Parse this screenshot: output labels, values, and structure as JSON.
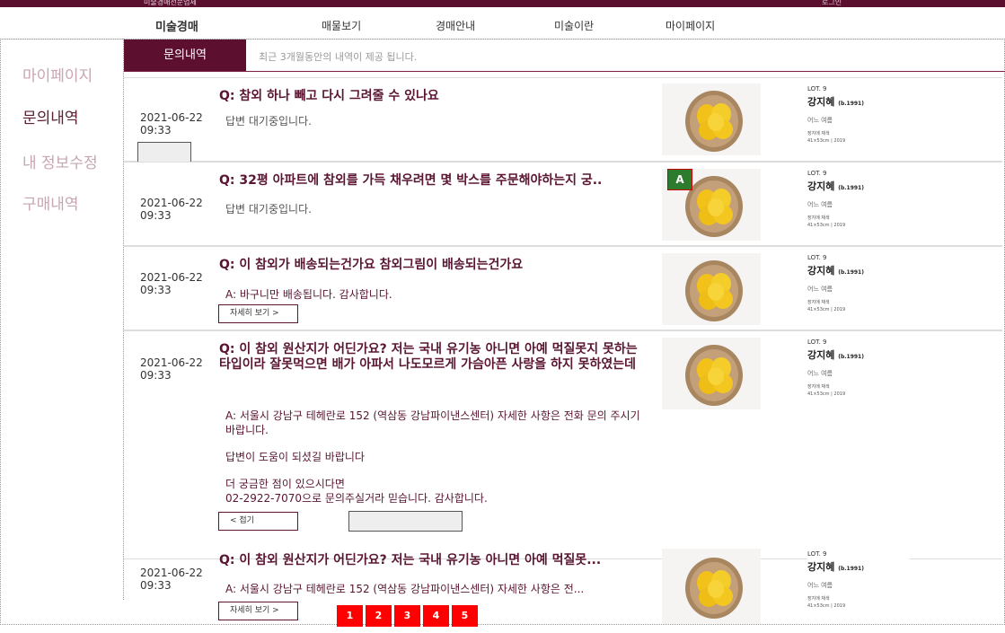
{
  "topbar": {
    "left_text": "미술경매전문업체",
    "right_text": "로그인"
  },
  "gnb": {
    "items": [
      "미술경매",
      "매물보기",
      "경매안내",
      "미술이란",
      "마이페이지"
    ]
  },
  "sidebar": {
    "items": [
      "마이페이지",
      "문의내역",
      "내 정보수정",
      "구매내역"
    ]
  },
  "tab": {
    "label": "문의내역",
    "note": "최근 3개월동안의 내역이 제공 됩니다."
  },
  "inquiries": [
    {
      "date": "2021-06-22",
      "time": "09:33",
      "question": "Q: 참외 하나 빼고 다시 그려줄 수 있나요",
      "answer": "답변 대기중입니다."
    },
    {
      "date": "2021-06-22",
      "time": "09:33",
      "question": "Q: 32평 아파트에 참외를 가득 채우려면 몇 박스를 주문해야하는지 궁..",
      "answer": "답변 대기중입니다.",
      "badge": "A"
    },
    {
      "date": "2021-06-22",
      "time": "09:33",
      "question": "Q: 이 참외가 배송되는건가요 참외그림이 배송되는건가요",
      "answer": "A: 바구니만 배송됩니다. 감사합니다.",
      "button": "자세히 보기 >"
    },
    {
      "date": "2021-06-22",
      "time": "09:33",
      "question": "Q: 이 참외 원산지가 어딘가요? 저는 국내 유기농 아니면 아예 먹질못지 못하는 타입이라 잘못먹으면 배가 아파서 나도모르게 가슴아픈 사랑을 하지 못하였는데",
      "answer_lines": [
        "A: 서울시 강남구 테헤란로 152 (역삼동 강남파이낸스센터) 자세한 사항은 전화 문의 주시기 바랍니다.",
        "답변이 도움이 되셨길 바랍니다",
        "더 궁금한 점이 있으시다면",
        "02-2922-7070으로 문의주실거라 믿습니다. 감사합니다."
      ],
      "button": "< 접기"
    },
    {
      "date": "2021-06-22",
      "time": "09:33",
      "question": "Q: 이 참외 원산지가 어딘가요? 저는 국내 유기농 아니면 아예 먹질못...",
      "answer": "A: 서울시 강남구 테헤란로 152 (역삼동 강남파이낸스센터) 자세한 사항은 전...",
      "button": "자세히 보기 >"
    }
  ],
  "artwork": {
    "lot": "LOT. 9",
    "artist": "강지혜",
    "birth": "(b.1991)",
    "title": "어느 여름",
    "meta1": "장지에 채색",
    "meta2": "41×53cm | 2019"
  },
  "pagination": [
    "1",
    "2",
    "3",
    "4",
    "5"
  ]
}
